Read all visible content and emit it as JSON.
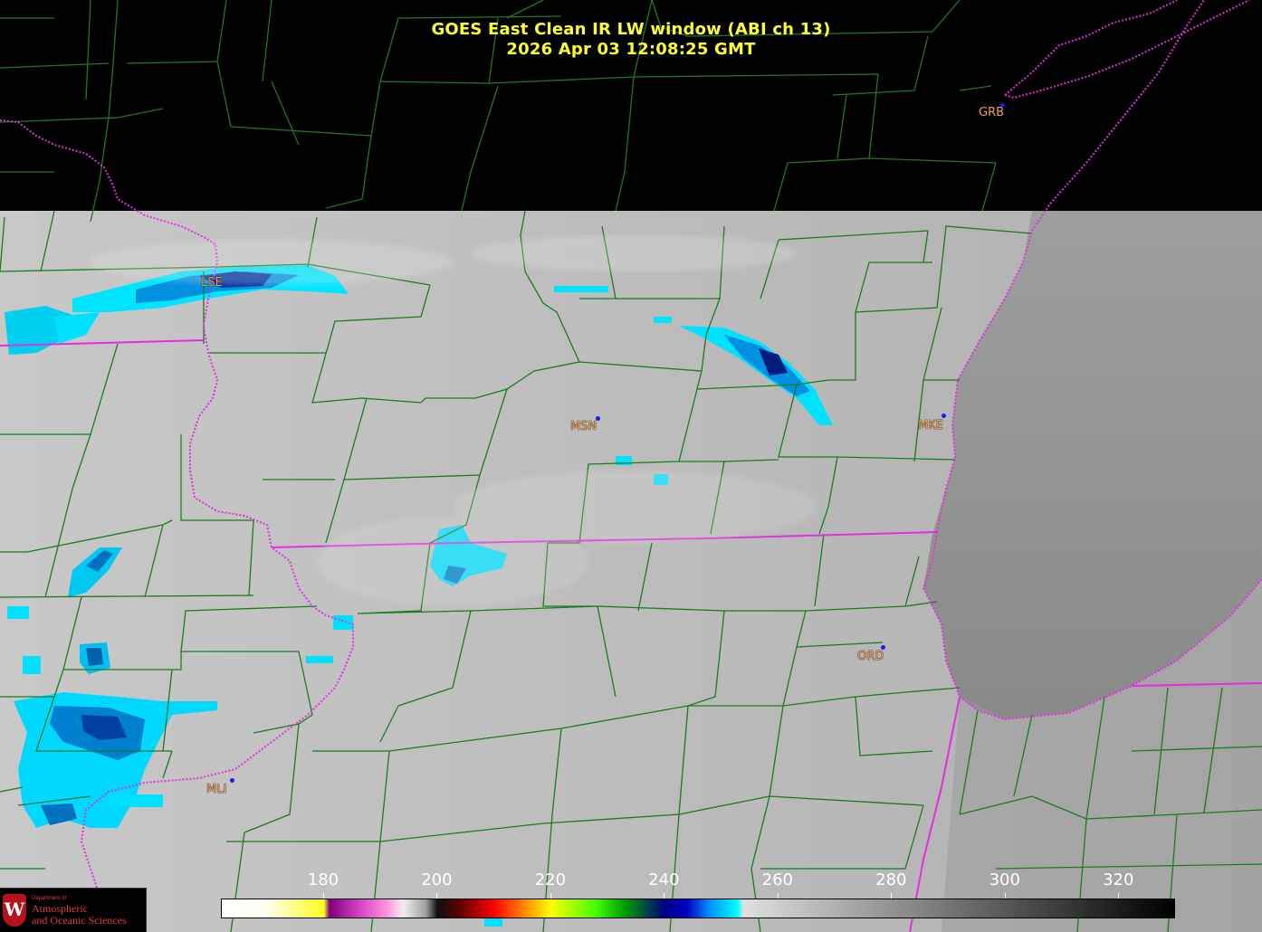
{
  "title": {
    "line1": "GOES East Clean IR LW window (ABI ch 13)",
    "line2": "2026 Apr 03  12:08:25 GMT"
  },
  "colors": {
    "title": "#ffff33",
    "county_lines": "#1e7a1e",
    "state_lines": "#e030e0",
    "station_label": "#f0a050",
    "station_dot": "#1a1aff",
    "no_data": "#000000"
  },
  "stations": [
    {
      "code": "GRB"
    },
    {
      "code": "LSE"
    },
    {
      "code": "MSN"
    },
    {
      "code": "MKE"
    },
    {
      "code": "ORD"
    },
    {
      "code": "MLI"
    }
  ],
  "colorbar": {
    "ticks": [
      "180",
      "200",
      "220",
      "240",
      "260",
      "280",
      "300",
      "320"
    ],
    "range": [
      162,
      330
    ],
    "stops": [
      {
        "v": 162,
        "c": "#ffffff"
      },
      {
        "v": 170,
        "c": "#fffff0"
      },
      {
        "v": 180,
        "c": "#ffff20"
      },
      {
        "v": 181,
        "c": "#800080"
      },
      {
        "v": 186,
        "c": "#d040c0"
      },
      {
        "v": 191,
        "c": "#ff90e0"
      },
      {
        "v": 194,
        "c": "#f0f0f0"
      },
      {
        "v": 198,
        "c": "#a0a0a0"
      },
      {
        "v": 200,
        "c": "#101010"
      },
      {
        "v": 204,
        "c": "#600000"
      },
      {
        "v": 210,
        "c": "#ff0000"
      },
      {
        "v": 215,
        "c": "#ff8000"
      },
      {
        "v": 220,
        "c": "#ffff00"
      },
      {
        "v": 228,
        "c": "#40ff00"
      },
      {
        "v": 233,
        "c": "#00a000"
      },
      {
        "v": 240,
        "c": "#000080"
      },
      {
        "v": 244,
        "c": "#0000c0"
      },
      {
        "v": 248,
        "c": "#0090ff"
      },
      {
        "v": 253,
        "c": "#00ffff"
      },
      {
        "v": 254,
        "c": "#e0e0e0"
      },
      {
        "v": 330,
        "c": "#000000"
      }
    ]
  },
  "logo": {
    "seal": "W",
    "small": "Department of",
    "line1": "Atmospheric",
    "line2": "and Oceanic Sciences"
  }
}
